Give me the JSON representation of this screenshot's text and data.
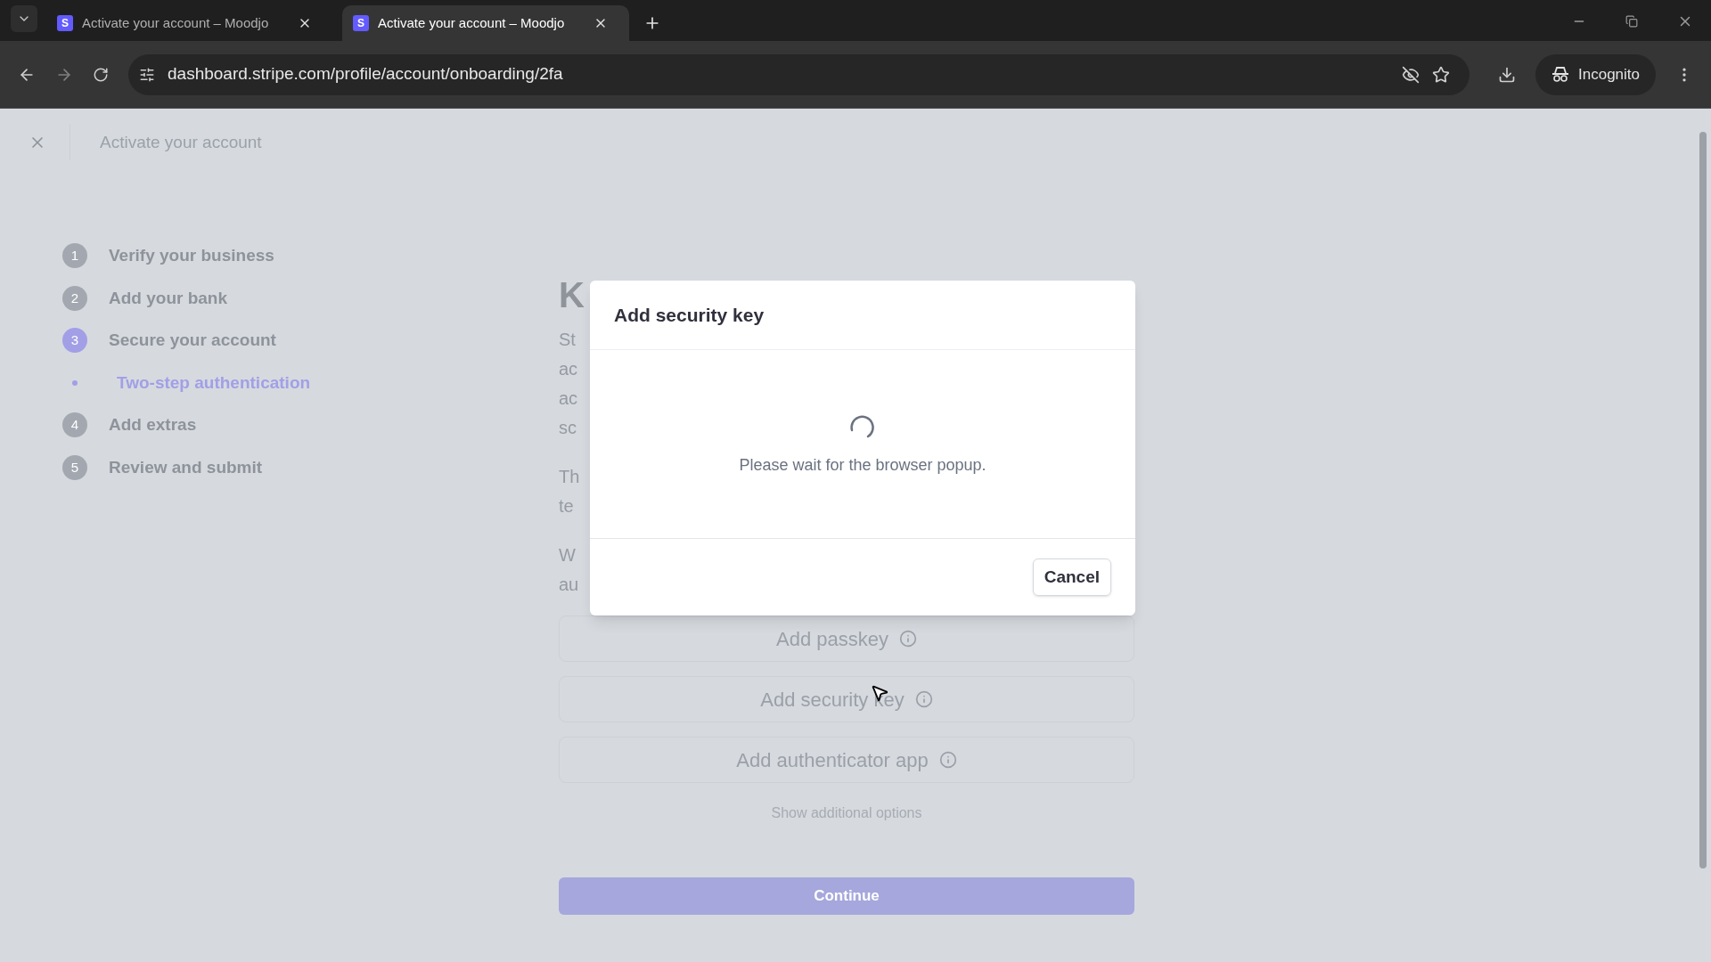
{
  "browser": {
    "tabs": [
      {
        "title": "Activate your account – Moodjo",
        "favicon": "S",
        "selected": false
      },
      {
        "title": "Activate your account – Moodjo",
        "favicon": "S",
        "selected": true
      }
    ],
    "url": "dashboard.stripe.com/profile/account/onboarding/2fa",
    "incognito_label": "Incognito"
  },
  "header": {
    "title": "Activate your account"
  },
  "steps": [
    {
      "number": "1",
      "label": "Verify your business",
      "selected": false
    },
    {
      "number": "2",
      "label": "Add your bank",
      "selected": false
    },
    {
      "number": "3",
      "label": "Secure your account",
      "selected": true,
      "children": [
        {
          "label": "Two-step authentication",
          "selected": true
        }
      ]
    },
    {
      "number": "4",
      "label": "Add extras",
      "selected": false
    },
    {
      "number": "5",
      "label": "Review and submit",
      "selected": false
    }
  ],
  "content": {
    "heading_fragment": "K",
    "paragraphs": [
      [
        "St",
        "ac",
        "ac",
        "sc"
      ],
      [
        "Th",
        "te"
      ],
      [
        "W",
        "au"
      ]
    ],
    "options": [
      {
        "label": "Add passkey"
      },
      {
        "label": "Add security key"
      },
      {
        "label": "Add authenticator app"
      }
    ],
    "more_link": "Show additional options",
    "continue_label": "Continue"
  },
  "dialog": {
    "title": "Add security key",
    "message": "Please wait for the browser popup.",
    "cancel_label": "Cancel"
  }
}
